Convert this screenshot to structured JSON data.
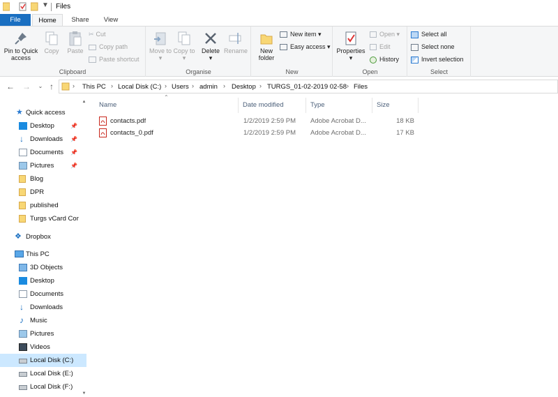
{
  "window": {
    "title": "Files"
  },
  "ribbon_tabs": [
    "File",
    "Home",
    "Share",
    "View"
  ],
  "groups": {
    "clipboard": {
      "label": "Clipboard",
      "pin": "Pin to Quick access",
      "copy": "Copy",
      "paste": "Paste",
      "cut": "Cut",
      "copy_path": "Copy path",
      "paste_shortcut": "Paste shortcut"
    },
    "organise": {
      "label": "Organise",
      "move_to": "Move to",
      "copy_to": "Copy to",
      "delete": "Delete",
      "rename": "Rename"
    },
    "new": {
      "label": "New",
      "new_folder": "New folder",
      "new_item": "New item",
      "easy_access": "Easy access"
    },
    "open": {
      "label": "Open",
      "properties": "Properties",
      "open": "Open",
      "edit": "Edit",
      "history": "History"
    },
    "select": {
      "label": "Select",
      "select_all": "Select all",
      "select_none": "Select none",
      "invert": "Invert selection"
    }
  },
  "breadcrumbs": [
    "This PC",
    "Local Disk (C:)",
    "Users",
    "admin",
    "Desktop",
    "TURGS_01-02-2019 02-58",
    "Files"
  ],
  "nav": {
    "quick_access": "Quick access",
    "quick_items": [
      {
        "label": "Desktop",
        "pinned": true
      },
      {
        "label": "Downloads",
        "pinned": true
      },
      {
        "label": "Documents",
        "pinned": true
      },
      {
        "label": "Pictures",
        "pinned": true
      },
      {
        "label": "Blog",
        "pinned": false
      },
      {
        "label": "DPR",
        "pinned": false
      },
      {
        "label": "published",
        "pinned": false
      },
      {
        "label": "Turgs vCard Cor",
        "pinned": false
      }
    ],
    "dropbox": "Dropbox",
    "this_pc": "This PC",
    "pc_items": [
      "3D Objects",
      "Desktop",
      "Documents",
      "Downloads",
      "Music",
      "Pictures",
      "Videos",
      "Local Disk (C:)",
      "Local Disk (E:)",
      "Local Disk (F:)"
    ],
    "selected": "Local Disk (C:)"
  },
  "columns": [
    "Name",
    "Date modified",
    "Type",
    "Size"
  ],
  "files": [
    {
      "name": "contacts.pdf",
      "date": "1/2/2019 2:59 PM",
      "type": "Adobe Acrobat D...",
      "size": "18 KB"
    },
    {
      "name": "contacts_0.pdf",
      "date": "1/2/2019 2:59 PM",
      "type": "Adobe Acrobat D...",
      "size": "17 KB"
    }
  ],
  "colors": {
    "accent": "#1a6fc1",
    "folder": "#f8d775",
    "selection": "#cce8ff",
    "pdf": "#c8261c"
  }
}
